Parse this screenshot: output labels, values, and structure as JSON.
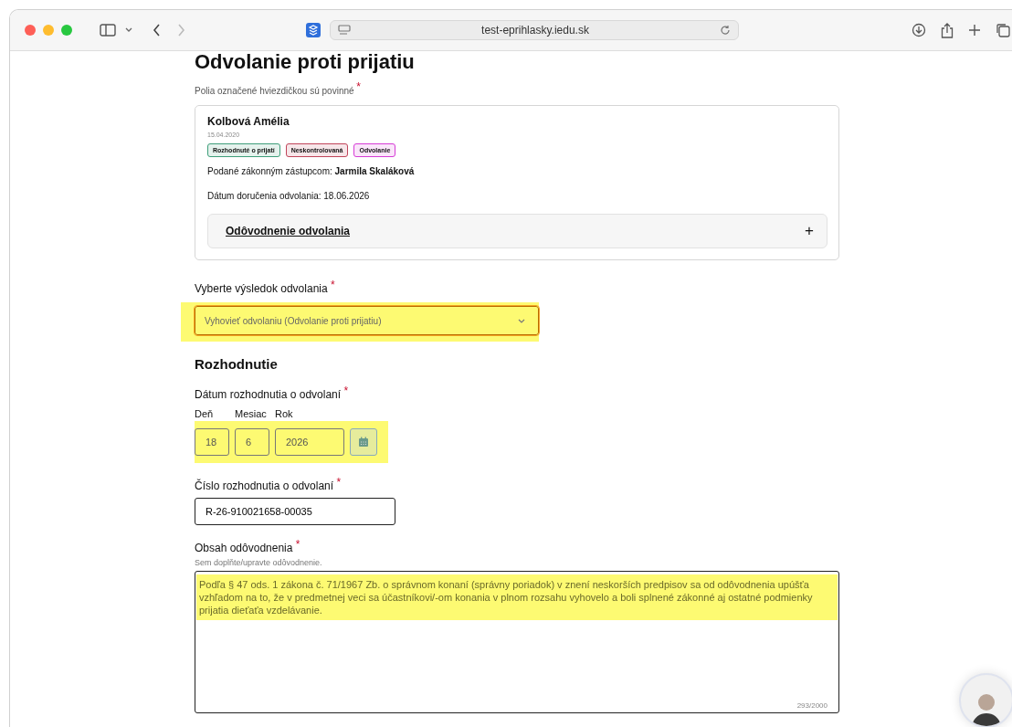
{
  "browser": {
    "url": "test-eprihlasky.iedu.sk"
  },
  "page": {
    "title": "Odvolanie proti prijatiu",
    "note": "Polia označené hviezdičkou sú povinné",
    "note_mark": "*"
  },
  "applicant": {
    "name": "Kolbová Amélia",
    "birth_date": "15.04.2020",
    "tags": [
      {
        "label": "Rozhodnuté o prijatí",
        "color": "#3e9e7a"
      },
      {
        "label": "Neskontrolovaná",
        "color": "#c0445a"
      },
      {
        "label": "Odvolanie",
        "color": "#d63cd6"
      }
    ],
    "submitted_label": "Podané zákonným zástupcom:",
    "submitted_by": "Jarmila Skaláková",
    "delivery": "Dátum doručenia odvolania: 18.06.2026",
    "accordion": {
      "title": "Odôvodnenie odvolania",
      "toggle": "+"
    }
  },
  "result": {
    "label": "Vyberte výsledok odvolania",
    "mark": "*",
    "value": "Vyhovieť odvolaniu (Odvolanie proti prijatiu)",
    "highlighted": true
  },
  "decision": {
    "heading": "Rozhodnutie",
    "date": {
      "label": "Dátum rozhodnutia o odvolaní",
      "mark": "*",
      "highlighted": true,
      "parts": [
        {
          "label": "Deň",
          "value": "18"
        },
        {
          "label": "Mesiac",
          "value": "6"
        },
        {
          "label": "Rok",
          "value": "2026"
        }
      ]
    },
    "number": {
      "label": "Číslo rozhodnutia o odvolaní",
      "mark": "*",
      "value": "R-26-910021658-00035"
    },
    "reason": {
      "label": "Obsah odôvodnenia",
      "mark": "*",
      "hint": "Sem doplňte/upravte odôvodnenie.",
      "value": "Podľa § 47 ods. 1 zákona č. 71/1967 Zb. o správnom konaní (správny poriadok) v znení neskorších predpisov sa od odôvodnenia upúšťa vzhľadom na to, že v predmetnej veci sa účastníkovi/-om konania v plnom rozsahu vyhovelo a boli splnené zákonné aj ostatné podmienky prijatia dieťaťa vzdelávanie.",
      "counter": "293/2000",
      "highlighted": true
    }
  }
}
